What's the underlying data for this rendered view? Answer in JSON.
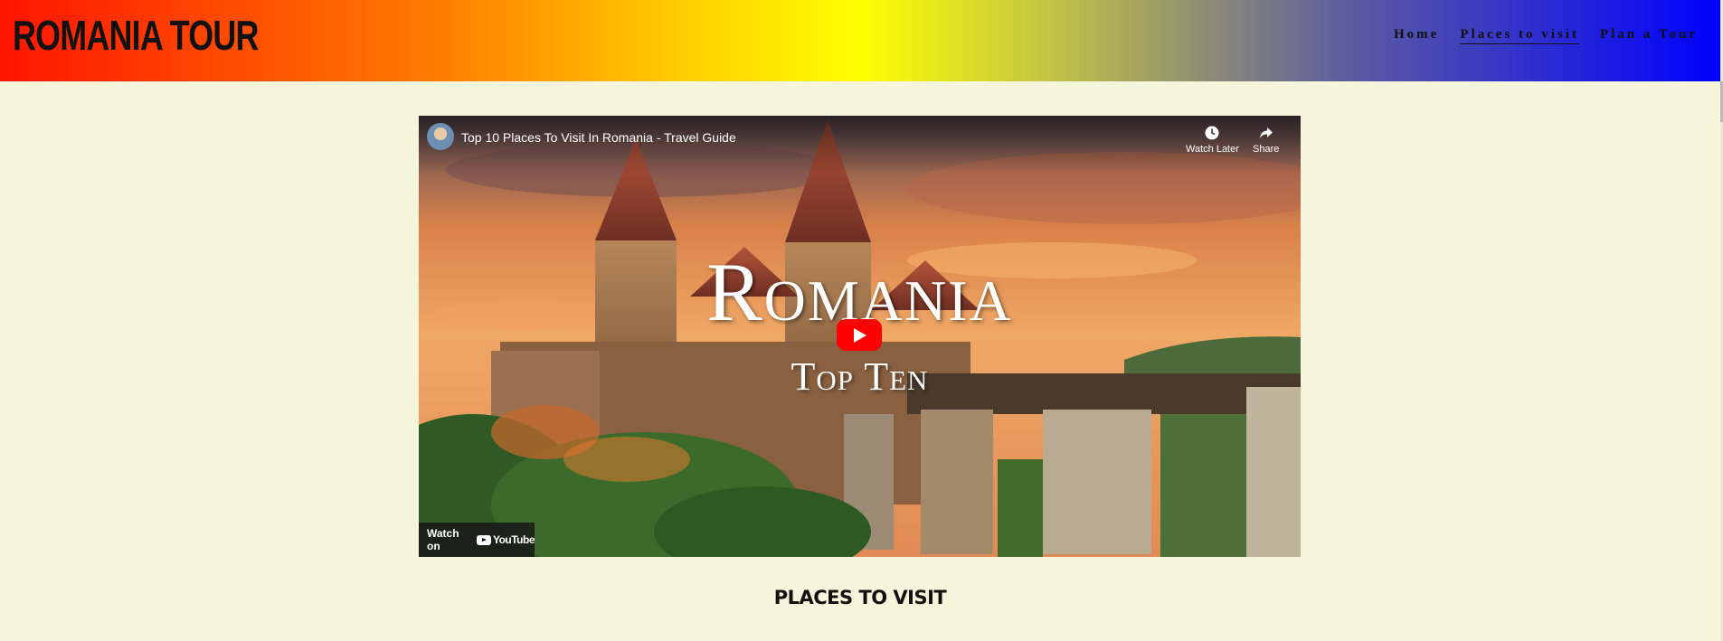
{
  "site": {
    "logo": "ROMANIA TOUR"
  },
  "nav": {
    "items": [
      {
        "label": "Home",
        "active": false
      },
      {
        "label": "Places to visit",
        "active": true
      },
      {
        "label": "Plan a Tour",
        "active": false
      }
    ]
  },
  "video": {
    "title": "Top 10 Places To Visit In Romania - Travel Guide",
    "watch_later": "Watch Later",
    "share": "Share",
    "thumbnail_title": "Romania",
    "thumbnail_subtitle": "Top Ten",
    "watch_on": "Watch on",
    "youtube": "YouTube"
  },
  "section": {
    "title": "PLACES TO VISIT"
  },
  "colors": {
    "page_bg": "#f5f5dc",
    "play_red": "#ff0000",
    "nav_text": "#111111"
  }
}
